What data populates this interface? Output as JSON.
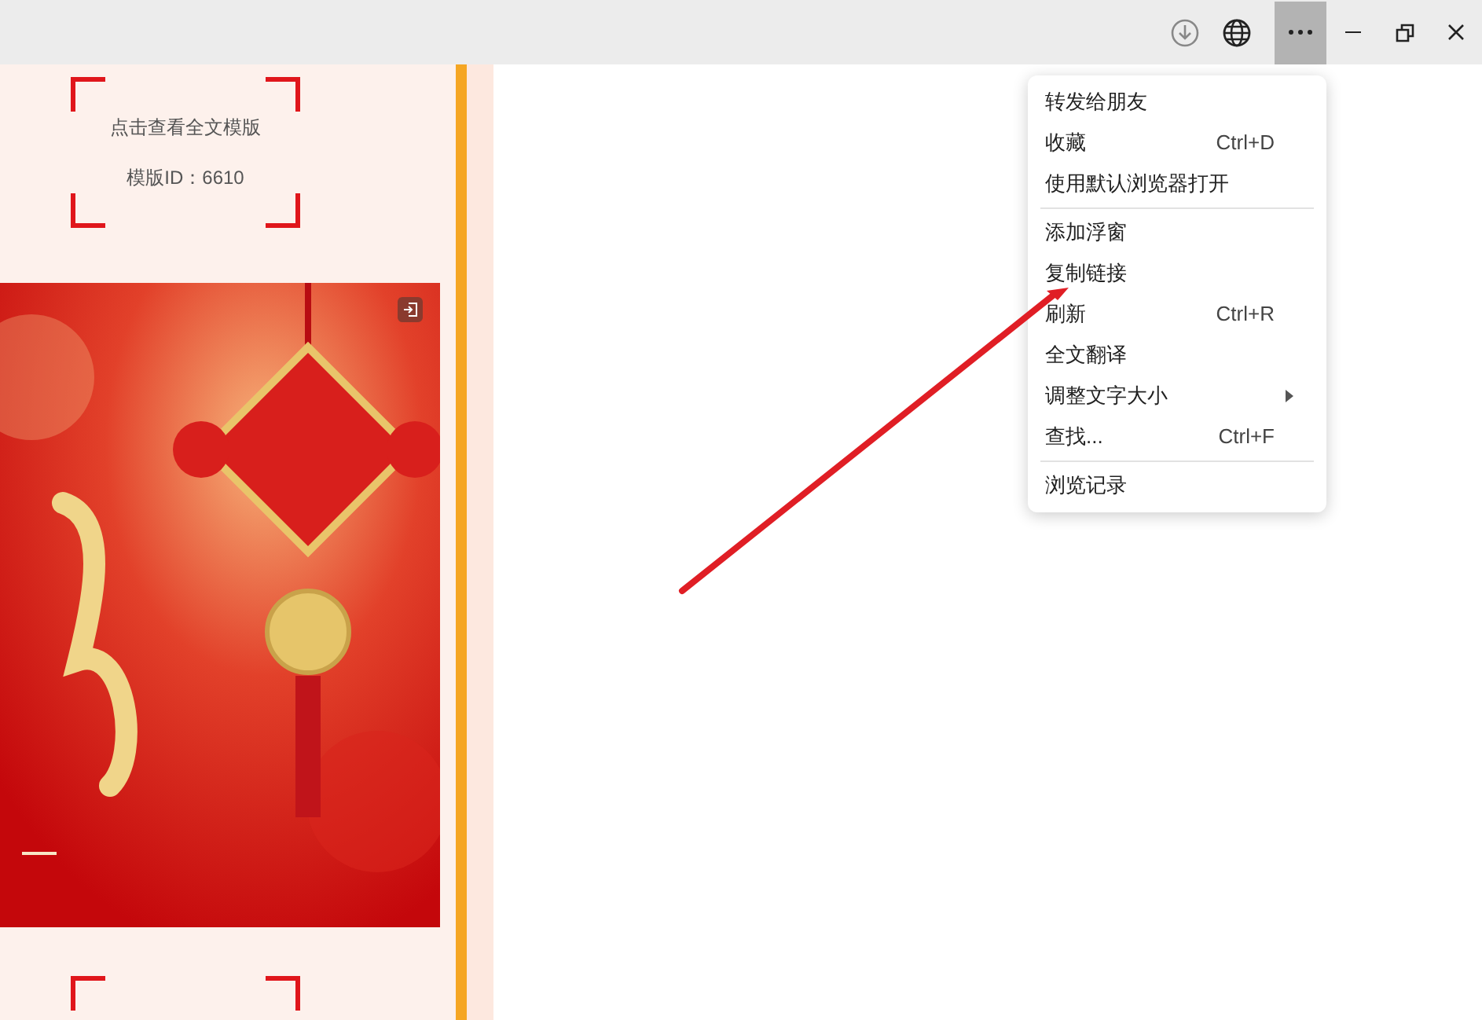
{
  "template_card": {
    "link": "点击查看全文模版",
    "template_id": "模版ID：6610"
  },
  "toolbar": {
    "more_menu_open": true
  },
  "menu": {
    "groups": [
      [
        {
          "label": "转发给朋友"
        },
        {
          "label": "收藏",
          "shortcut": "Ctrl+D"
        },
        {
          "label": "使用默认浏览器打开"
        }
      ],
      [
        {
          "label": "添加浮窗"
        },
        {
          "label": "复制链接"
        },
        {
          "label": "刷新",
          "shortcut": "Ctrl+R"
        },
        {
          "label": "全文翻译"
        },
        {
          "label": "调整文字大小",
          "submenu": true
        },
        {
          "label": "查找...",
          "shortcut": "Ctrl+F"
        }
      ],
      [
        {
          "label": "浏览记录"
        }
      ]
    ]
  }
}
